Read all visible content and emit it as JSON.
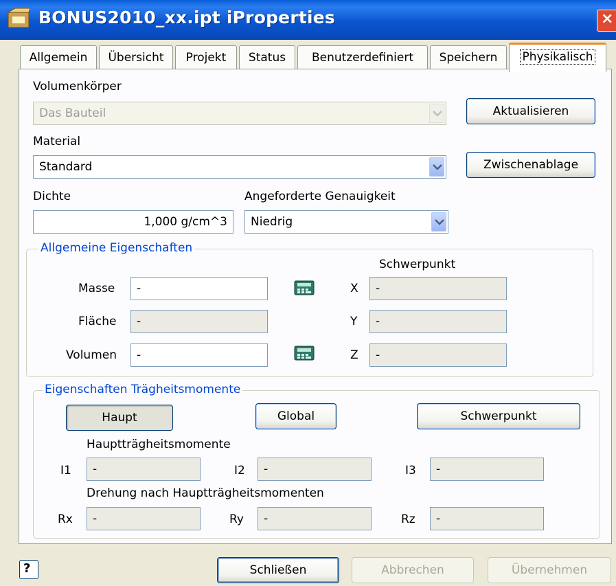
{
  "window": {
    "title": "BONUS2010_xx.ipt iProperties",
    "close_label": "×"
  },
  "tabs": [
    {
      "label": "Allgemein"
    },
    {
      "label": "Übersicht"
    },
    {
      "label": "Projekt"
    },
    {
      "label": "Status"
    },
    {
      "label": "Benutzerdefiniert"
    },
    {
      "label": "Speichern"
    },
    {
      "label": "Physikalisch",
      "active": true
    }
  ],
  "physical": {
    "solid_label": "Volumenkörper",
    "solid_value": "Das Bauteil",
    "update_button": "Aktualisieren",
    "material_label": "Material",
    "material_value": "Standard",
    "clipboard_button": "Zwischenablage",
    "density_label": "Dichte",
    "density_value": "1,000 g/cm^3",
    "accuracy_label": "Angeforderte Genauigkeit",
    "accuracy_value": "Niedrig"
  },
  "general_props": {
    "title": "Allgemeine Eigenschaften",
    "center_of_gravity_label": "Schwerpunkt",
    "mass_label": "Masse",
    "mass_value": "-",
    "area_label": "Fläche",
    "area_value": "-",
    "volume_label": "Volumen",
    "volume_value": "-",
    "x_label": "X",
    "x_value": "-",
    "y_label": "Y",
    "y_value": "-",
    "z_label": "Z",
    "z_value": "-"
  },
  "inertia": {
    "title": "Eigenschaften Trägheitsmomente",
    "haupt_button": "Haupt",
    "global_button": "Global",
    "schwerpunkt_button": "Schwerpunkt",
    "principal_label": "Hauptträgheitsmomente",
    "i1_label": "I1",
    "i1_value": "-",
    "i2_label": "I2",
    "i2_value": "-",
    "i3_label": "I3",
    "i3_value": "-",
    "rotation_label": "Drehung nach Hauptträgheitsmomenten",
    "rx_label": "Rx",
    "rx_value": "-",
    "ry_label": "Ry",
    "ry_value": "-",
    "rz_label": "Rz",
    "rz_value": "-"
  },
  "footer": {
    "help_label": "?",
    "close_button": "Schließen",
    "cancel_button": "Abbrechen",
    "apply_button": "Übernehmen"
  },
  "colors": {
    "titlebar": "#0a5fd8",
    "group_title": "#0046d5",
    "active_tab_accent": "#e68b2c"
  }
}
